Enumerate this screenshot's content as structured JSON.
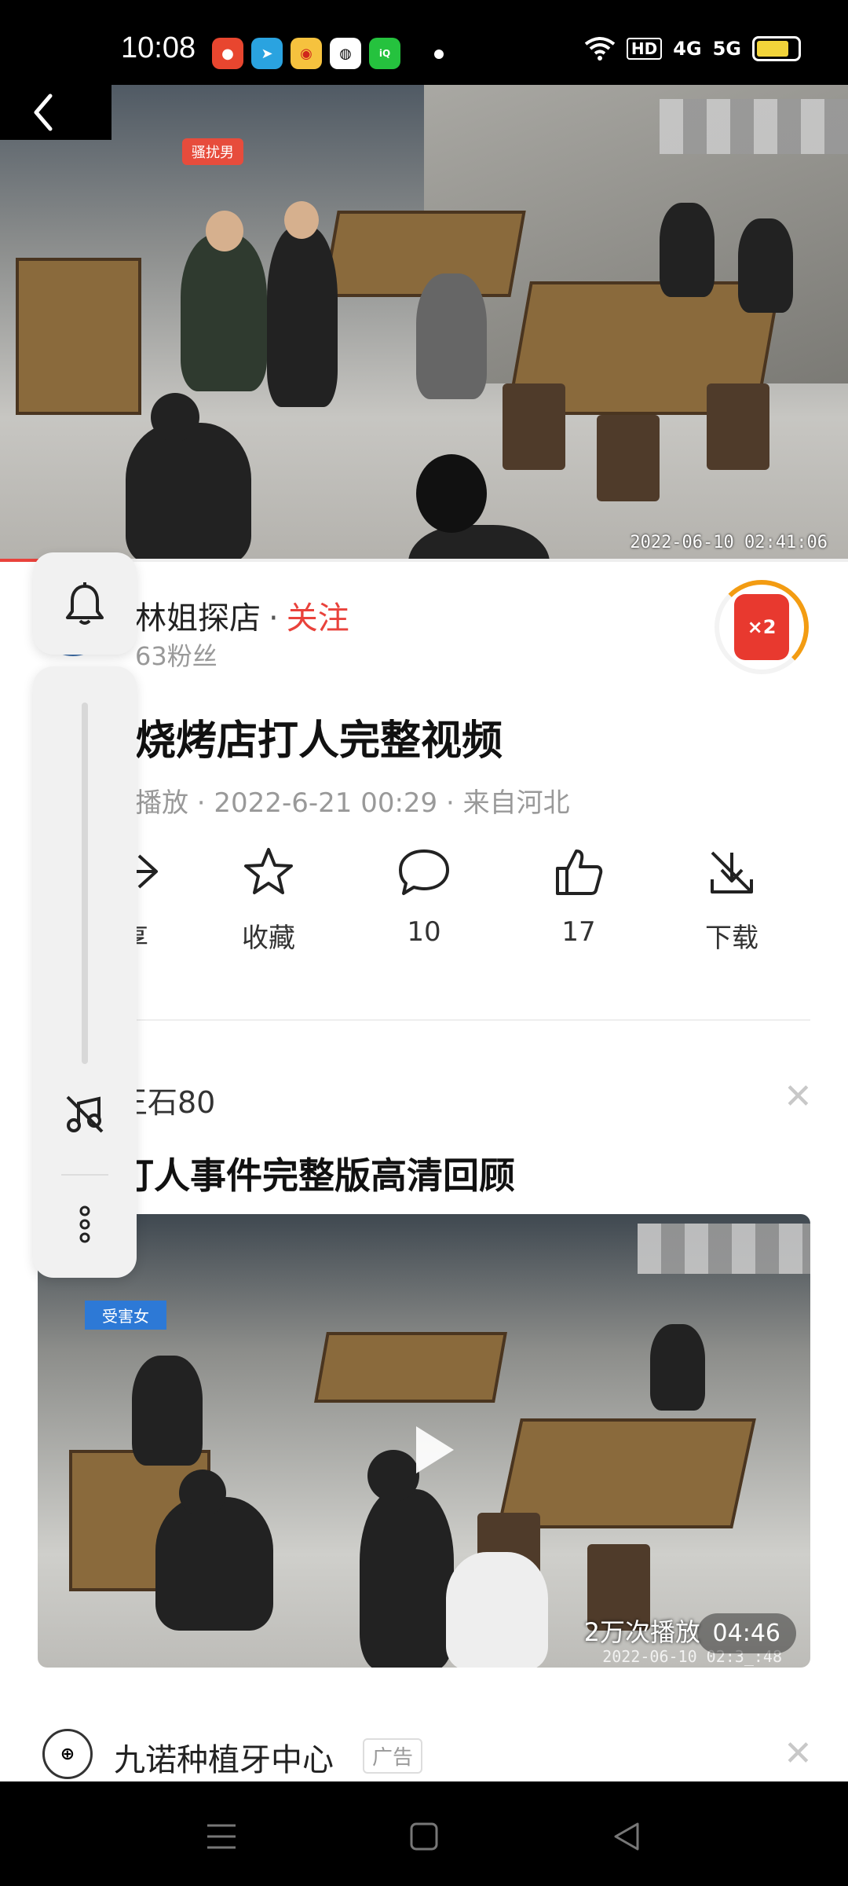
{
  "status_bar": {
    "time": "10:08",
    "notification_icons": [
      "app-icon",
      "telegram-icon",
      "weibo-icon",
      "wechat-icon",
      "iqiyi-icon"
    ],
    "hd_label": "HD",
    "net1": "4G",
    "net2": "5G"
  },
  "video": {
    "overlay_tag": "骚扰男",
    "timestamp": "2022-06-10 02:41:06",
    "progress_fraction": 0.045
  },
  "author": {
    "name": "林姐探店",
    "separator": "·",
    "follow_label": "关注",
    "fans": "63粉丝",
    "reward_label": "×2"
  },
  "title": "烧烤店打人完整视频",
  "meta": "播放 · 2022-6-21 00:29 · 来自河北",
  "actions": [
    {
      "label": "享",
      "icon": "share-icon"
    },
    {
      "label": "收藏",
      "icon": "star-icon"
    },
    {
      "label": "10",
      "icon": "comment-icon"
    },
    {
      "label": "17",
      "icon": "thumbs-up-icon"
    },
    {
      "label": "下载",
      "icon": "download-icon"
    }
  ],
  "related": {
    "author": "王石80",
    "title": "打人事件完整版高清回顾",
    "victim_tag": "受害女",
    "plays": "2万次播放",
    "duration": "04:46",
    "timestamp": "2022-06-10 02:3_:48"
  },
  "ad": {
    "name": "九诺种植牙中心",
    "tag": "广告"
  },
  "colors": {
    "accent": "#e9423b",
    "secondary_text": "#999999",
    "panel_bg": "#f1f1f1"
  }
}
